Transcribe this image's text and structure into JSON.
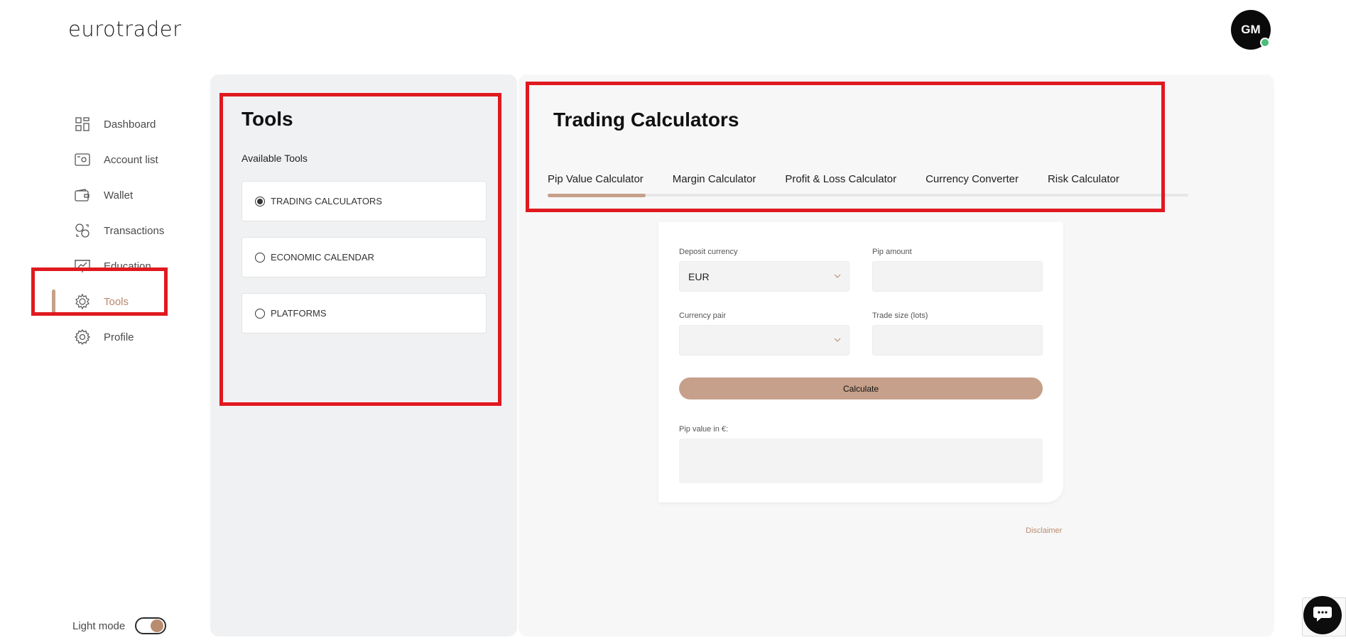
{
  "brand": {
    "logo_text": "eurotrader"
  },
  "user": {
    "initials": "GM",
    "status_color": "#4cbb7a"
  },
  "nav": {
    "items": [
      {
        "label": "Dashboard",
        "icon": "dashboard-icon"
      },
      {
        "label": "Account list",
        "icon": "account-list-icon"
      },
      {
        "label": "Wallet",
        "icon": "wallet-icon"
      },
      {
        "label": "Transactions",
        "icon": "transactions-icon"
      },
      {
        "label": "Education",
        "icon": "education-icon"
      },
      {
        "label": "Tools",
        "icon": "tools-icon",
        "active": true
      },
      {
        "label": "Profile",
        "icon": "profile-gear-icon"
      }
    ],
    "light_mode_label": "Light mode"
  },
  "tools": {
    "title": "Tools",
    "subtitle": "Available Tools",
    "options": [
      {
        "label": "TRADING CALCULATORS",
        "selected": true
      },
      {
        "label": "ECONOMIC CALENDAR",
        "selected": false
      },
      {
        "label": "PLATFORMS",
        "selected": false
      }
    ]
  },
  "calculators": {
    "title": "Trading Calculators",
    "tabs": [
      "Pip Value Calculator",
      "Margin Calculator",
      "Profit & Loss Calculator",
      "Currency Converter",
      "Risk Calculator"
    ],
    "active_tab": "Pip Value Calculator",
    "form": {
      "deposit_currency_label": "Deposit currency",
      "deposit_currency_value": "EUR",
      "pip_amount_label": "Pip amount",
      "pip_amount_value": "",
      "currency_pair_label": "Currency pair",
      "currency_pair_value": "",
      "trade_size_label": "Trade size (lots)",
      "trade_size_value": "",
      "calculate_label": "Calculate",
      "result_label": "Pip value in €:",
      "result_value": ""
    },
    "disclaimer": "Disclaimer"
  },
  "colors": {
    "accent": "#c6a08a",
    "highlight": "#e0191f",
    "active_text": "#b8876a"
  }
}
